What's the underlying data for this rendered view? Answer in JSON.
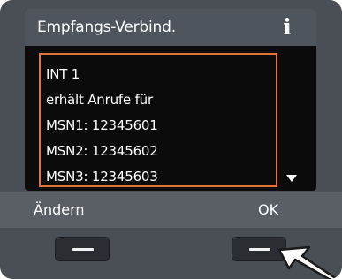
{
  "screen": {
    "title": "Empfangs-Verbind.",
    "info_icon": "i",
    "list_items": [
      "INT 1",
      "erhält Anrufe für",
      "MSN1: 12345601",
      "MSN2: 12345602",
      "MSN3: 12345603"
    ],
    "scroll_indicator_icon": "down-triangle"
  },
  "softkeys": {
    "left_label": "Ändern",
    "right_label": "OK"
  },
  "colors": {
    "device_body": "#4a4f55",
    "title_bar": "#4f555c",
    "screen_background": "#0b0b0b",
    "selection_border": "#e2743a",
    "softkey_bar": "#5a5f66",
    "text": "#ffffff"
  },
  "pointer_icon": "arrow-pointing-at-right-softkey"
}
